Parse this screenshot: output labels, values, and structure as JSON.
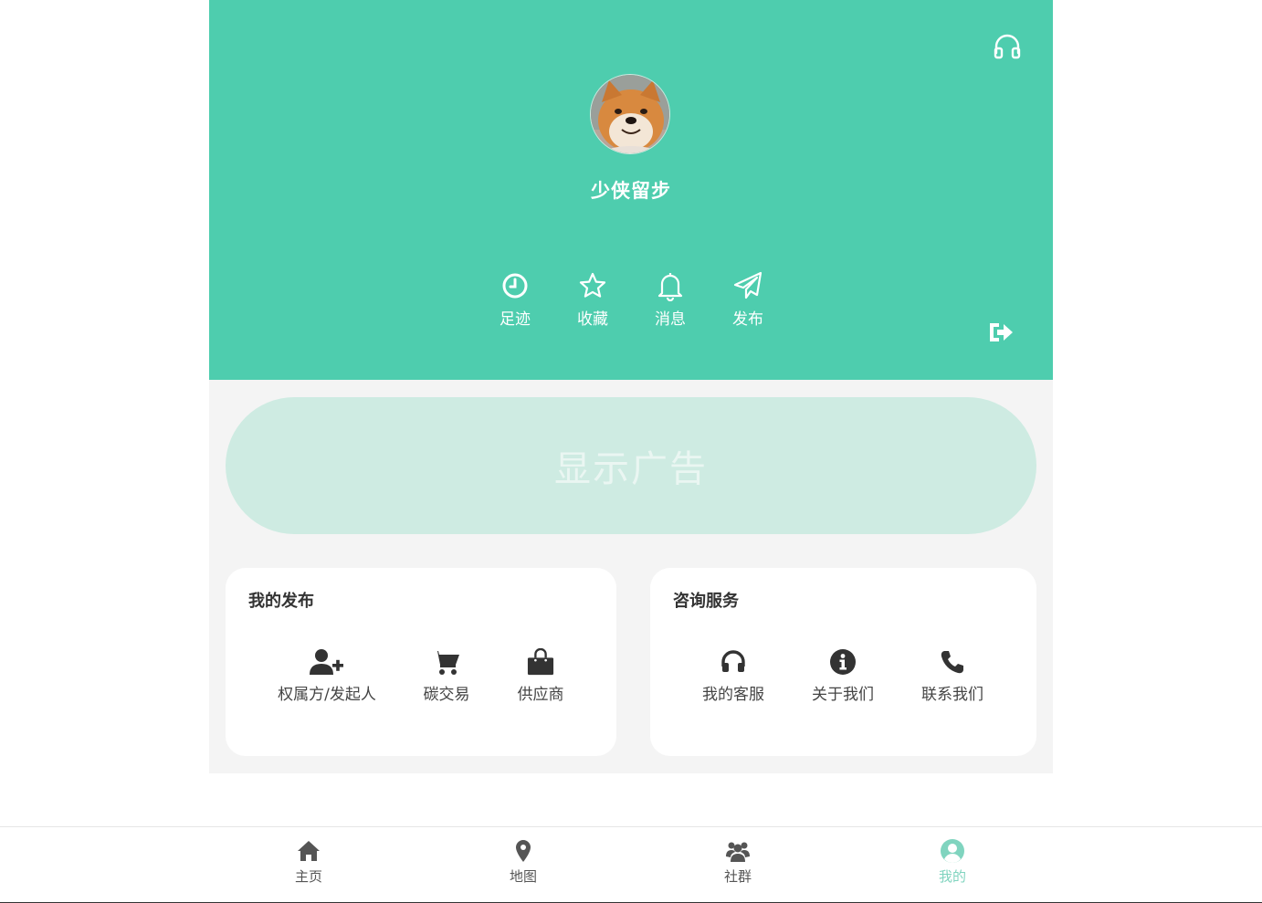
{
  "profile": {
    "username": "少侠留步",
    "avatar_icon": "shiba-dog-avatar"
  },
  "header": {
    "support_icon": "headphones-icon",
    "logout_icon": "logout-icon",
    "quick_actions": [
      {
        "label": "足迹",
        "icon": "clock-icon"
      },
      {
        "label": "收藏",
        "icon": "star-icon"
      },
      {
        "label": "消息",
        "icon": "bell-icon"
      },
      {
        "label": "发布",
        "icon": "paper-plane-icon"
      }
    ]
  },
  "ad": {
    "text": "显示广告"
  },
  "my_publish": {
    "title": "我的发布",
    "items": [
      {
        "label": "权属方/发起人",
        "icon": "user-plus-icon"
      },
      {
        "label": "碳交易",
        "icon": "cart-icon"
      },
      {
        "label": "供应商",
        "icon": "shopping-bag-icon"
      }
    ]
  },
  "consult": {
    "title": "咨询服务",
    "items": [
      {
        "label": "我的客服",
        "icon": "headset-icon"
      },
      {
        "label": "关于我们",
        "icon": "info-icon"
      },
      {
        "label": "联系我们",
        "icon": "phone-icon"
      }
    ]
  },
  "tabbar": {
    "tabs": [
      {
        "label": "主页",
        "icon": "home-icon"
      },
      {
        "label": "地图",
        "icon": "map-pin-icon"
      },
      {
        "label": "社群",
        "icon": "users-icon"
      },
      {
        "label": "我的",
        "icon": "user-circle-icon",
        "active": true
      }
    ],
    "active_color": "#80d4bf"
  },
  "colors": {
    "brand": "#4ecdae",
    "ad_bg": "#ceebe2",
    "page_bg": "#f4f4f4"
  }
}
